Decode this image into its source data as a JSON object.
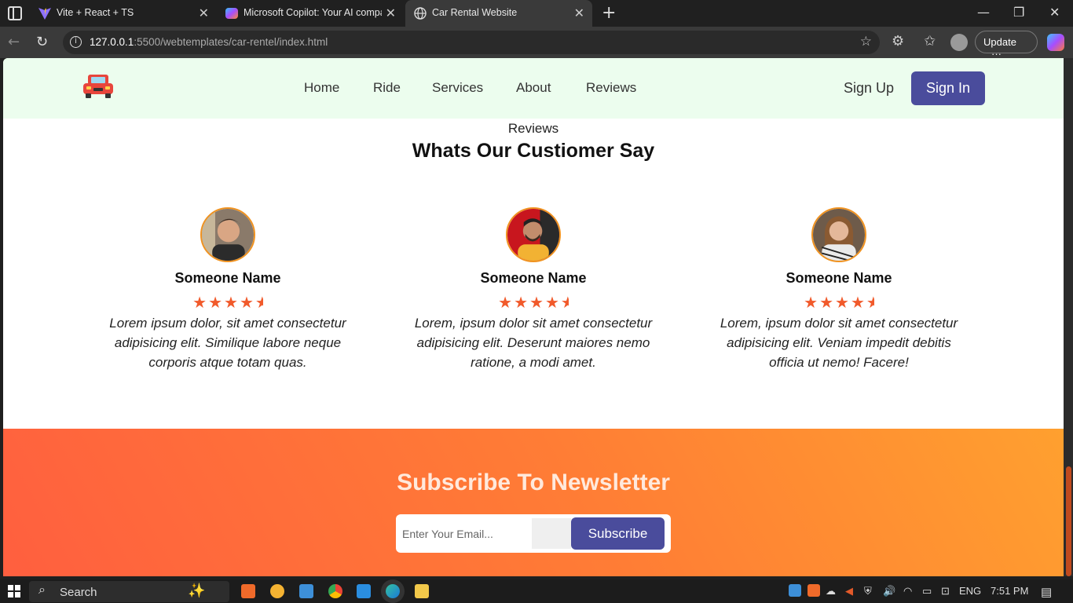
{
  "browser": {
    "tabs": [
      {
        "title": "Vite + React + TS",
        "icon": "vite-icon",
        "active": false
      },
      {
        "title": "Microsoft Copilot: Your AI compa",
        "icon": "copilot-icon",
        "active": false
      },
      {
        "title": "Car Rental Website",
        "icon": "globe-icon",
        "active": true
      }
    ],
    "url_host": "127.0.0.1",
    "url_rest": ":5500/webtemplates/car-rentel/index.html",
    "update_label": "Update",
    "more_label": "···"
  },
  "site": {
    "nav": [
      "Home",
      "Ride",
      "Services",
      "About",
      "Reviews"
    ],
    "signup_label": "Sign Up",
    "signin_label": "Sign In",
    "accent_color": "#4a4c9c",
    "header_bg": "#ecfdee"
  },
  "reviews": {
    "eyebrow": "Reviews",
    "title": "Whats Our Custiomer Say",
    "rating": 4.5,
    "items": [
      {
        "name": "Someone Name",
        "text": "Lorem ipsum dolor, sit amet consectetur adipisicing elit. Similique labore neque corporis atque totam quas."
      },
      {
        "name": "Someone Name",
        "text": "Lorem, ipsum dolor sit amet consectetur adipisicing elit. Deserunt maiores nemo ratione, a modi amet."
      },
      {
        "name": "Someone Name",
        "text": "Lorem, ipsum dolor sit amet consectetur adipisicing elit. Veniam impedit debitis officia ut nemo! Facere!"
      }
    ]
  },
  "newsletter": {
    "title": "Subscribe To Newsletter",
    "placeholder": "Enter Your Email...",
    "button_label": "Subscribe"
  },
  "taskbar": {
    "search_label": "Search",
    "lang": "ENG",
    "time": "7:51 PM"
  }
}
